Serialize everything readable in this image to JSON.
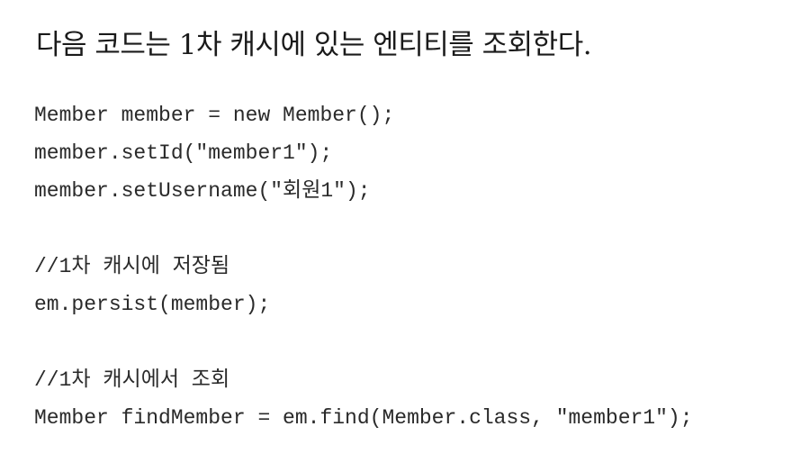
{
  "heading": "다음 코드는 1차 캐시에 있는 엔티티를 조회한다.",
  "code_lines": [
    "Member member = new Member();",
    "member.setId(\"member1\");",
    "member.setUsername(\"회원1\");",
    "//1차 캐시에 저장됨",
    "em.persist(member);",
    "//1차 캐시에서 조회",
    "Member findMember = em.find(Member.class, \"member1\");"
  ]
}
